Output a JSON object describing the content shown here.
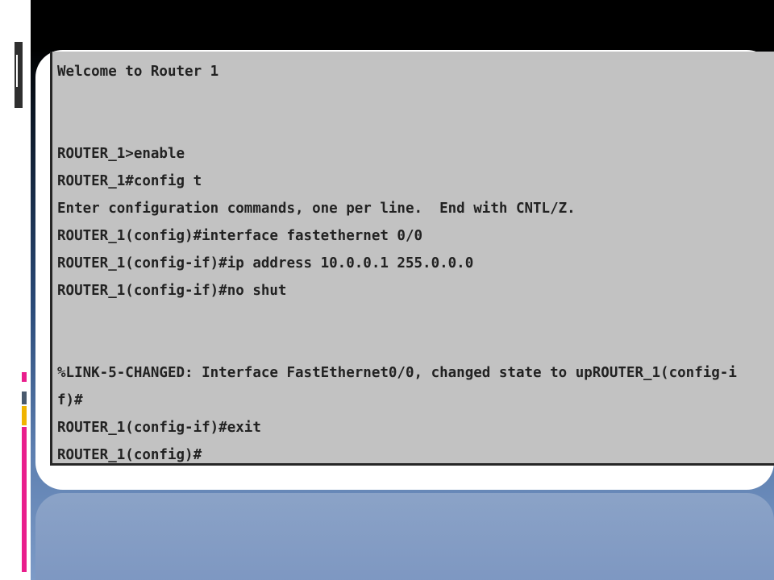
{
  "terminal": {
    "lines": [
      "Welcome to Router 1",
      "",
      "",
      "ROUTER_1>enable",
      "ROUTER_1#config t",
      "Enter configuration commands, one per line.  End with CNTL/Z.",
      "ROUTER_1(config)#interface fastethernet 0/0",
      "ROUTER_1(config-if)#ip address 10.0.0.1 255.0.0.0",
      "ROUTER_1(config-if)#no shut",
      "",
      "",
      "%LINK-5-CHANGED: Interface FastEthernet0/0, changed state to upROUTER_1(config-i",
      "f)#",
      "ROUTER_1(config-if)#exit",
      "ROUTER_1(config)#"
    ]
  },
  "colors": {
    "terminal_bg": "#c2c2c2",
    "terminal_text": "#222222",
    "slide_top": "#000000",
    "slide_bottom": "#7d9bc7",
    "accent_pink": "#e91e8c",
    "accent_yellow": "#f0b400"
  }
}
